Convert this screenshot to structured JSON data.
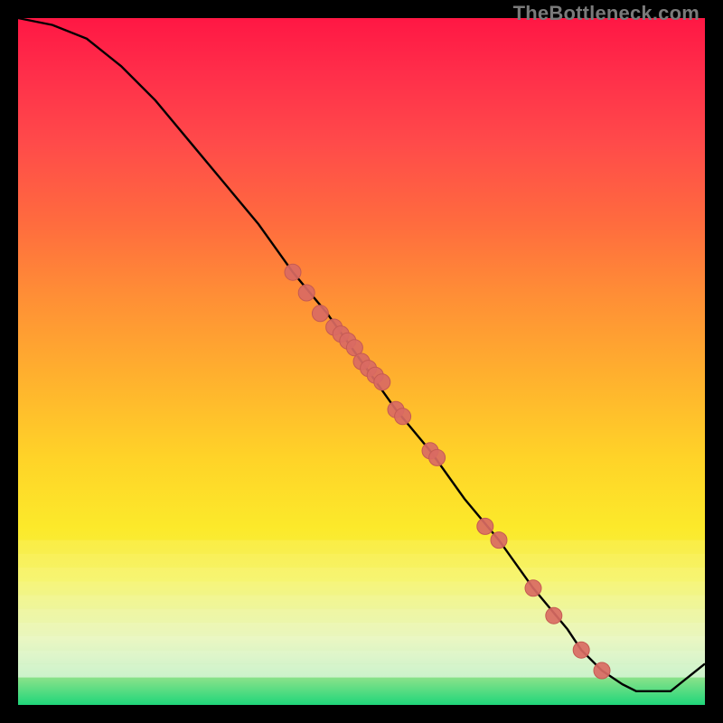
{
  "watermark": "TheBottleneck.com",
  "chart_data": {
    "type": "line",
    "title": "",
    "xlabel": "",
    "ylabel": "",
    "xlim": [
      0,
      100
    ],
    "ylim": [
      0,
      100
    ],
    "grid": false,
    "legend": false,
    "curve": {
      "x": [
        0,
        5,
        10,
        15,
        20,
        25,
        30,
        35,
        40,
        45,
        50,
        55,
        60,
        65,
        70,
        75,
        80,
        82,
        85,
        88,
        90,
        92,
        95,
        100
      ],
      "y": [
        100,
        99,
        97,
        93,
        88,
        82,
        76,
        70,
        63,
        57,
        50,
        43,
        37,
        30,
        24,
        17,
        11,
        8,
        5,
        3,
        2,
        2,
        2,
        6
      ]
    },
    "markers": {
      "x": [
        40,
        42,
        44,
        46,
        47,
        48,
        49,
        50,
        51,
        52,
        53,
        55,
        56,
        60,
        61,
        68,
        70,
        75,
        78,
        82,
        85
      ],
      "y": [
        63,
        60,
        57,
        55,
        54,
        53,
        52,
        50,
        49,
        48,
        47,
        43,
        42,
        37,
        36,
        26,
        24,
        17,
        13,
        8,
        5
      ],
      "color": "#d96a63",
      "radius": 9
    },
    "significance_bands": [
      {
        "y_start": 24,
        "y_end": 22,
        "opacity": 0.1
      },
      {
        "y_start": 22,
        "y_end": 20,
        "opacity": 0.16
      },
      {
        "y_start": 20,
        "y_end": 18,
        "opacity": 0.22
      },
      {
        "y_start": 18,
        "y_end": 16,
        "opacity": 0.28
      },
      {
        "y_start": 16,
        "y_end": 14,
        "opacity": 0.34
      },
      {
        "y_start": 14,
        "y_end": 12,
        "opacity": 0.4
      },
      {
        "y_start": 12,
        "y_end": 10,
        "opacity": 0.46
      },
      {
        "y_start": 10,
        "y_end": 8,
        "opacity": 0.52
      },
      {
        "y_start": 8,
        "y_end": 6,
        "opacity": 0.56
      },
      {
        "y_start": 6,
        "y_end": 4,
        "opacity": 0.56
      }
    ],
    "colors": {
      "curve": "#000000",
      "marker_fill": "#d96a63",
      "marker_stroke": "#c55a53"
    }
  }
}
